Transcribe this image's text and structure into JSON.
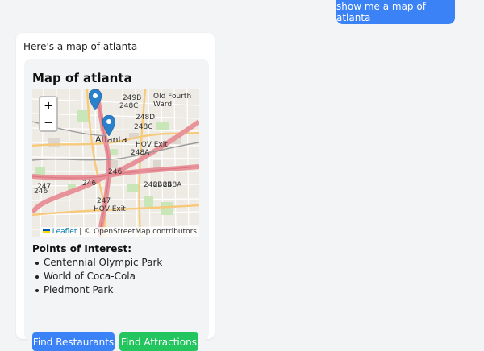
{
  "chat": {
    "user_message": "show me a map of atlanta",
    "assistant_message": "Here's a map of atlanta"
  },
  "map_card": {
    "title": "Map of atlanta",
    "zoom_in": "+",
    "zoom_out": "−",
    "labels": {
      "city": "Atlanta",
      "neighborhood": "Old Fourth Ward",
      "highways": [
        "249B",
        "248C",
        "248D",
        "248A",
        "248C",
        "246",
        "248B",
        "247",
        "HOV Exit",
        "HOV Exit",
        "248B",
        "248A",
        "246",
        "246",
        "247"
      ]
    },
    "attribution": {
      "leaflet": "Leaflet",
      "separator": " | ",
      "osm": "© OpenStreetMap contributors"
    },
    "poi_heading": "Points of Interest:",
    "points_of_interest": [
      "Centennial Olympic Park",
      "World of Coca-Cola",
      "Piedmont Park"
    ],
    "buttons": {
      "restaurants": "Find Restaurants",
      "attractions": "Find Attractions"
    }
  },
  "colors": {
    "primary": "#3b82f6",
    "success": "#22c55e",
    "marker": "#2a81cb"
  }
}
